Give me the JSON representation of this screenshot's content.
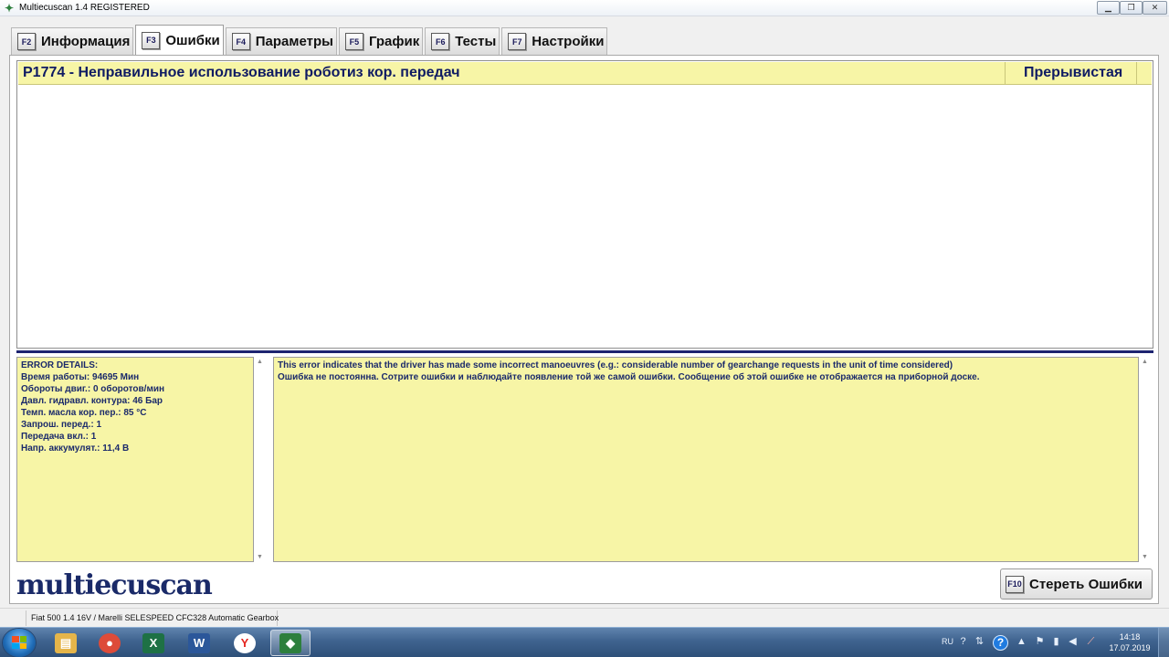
{
  "window": {
    "title": "Multiecuscan 1.4 REGISTERED",
    "min_glyph": "▁",
    "max_glyph": "❐",
    "close_glyph": "✕"
  },
  "tabs": [
    {
      "key": "F2",
      "label": "Информация"
    },
    {
      "key": "F3",
      "label": "Ошибки",
      "active": true
    },
    {
      "key": "F4",
      "label": "Параметры"
    },
    {
      "key": "F5",
      "label": "График"
    },
    {
      "key": "F6",
      "label": "Тесты"
    },
    {
      "key": "F7",
      "label": "Настройки"
    }
  ],
  "errors": {
    "rows": [
      {
        "code": "P1774 - Неправильное использование роботиз кор. передач",
        "status": "Прерывистая"
      }
    ]
  },
  "details": {
    "header": "ERROR DETAILS:",
    "lines": [
      "Время работы: 94695 Мин",
      "Обороты двиг.: 0 оборотов/мин",
      "Давл. гидравл. контура: 46 Бар",
      "Темп. масла кор. пер.: 85 °C",
      "Запрош. перед.: 1",
      "Передача вкл.: 1",
      "Напр. аккумулят.: 11,4 В"
    ]
  },
  "description": {
    "line1": "This error indicates that the driver has made some incorrect manoeuvres (e.g.: considerable number of gearchange requests in the unit of time considered)",
    "line2": "Ошибка не постоянна. Сотрите ошибки и наблюдайте появление той же самой ошибки. Сообщение об этой ошибке не отображается на приборной доске."
  },
  "logo": "multiecuscan",
  "clear_button": {
    "key": "F10",
    "label": "Стереть Ошибки"
  },
  "status": {
    "vehicle": "Fiat 500 1.4 16V / Marelli SELESPEED CFC328 Automatic Gearbox"
  },
  "taskbar": {
    "apps": [
      {
        "name": "explorer",
        "glyph": "▤",
        "color": "#e5b54a"
      },
      {
        "name": "chrome",
        "glyph": "●",
        "color": "#dd4b39"
      },
      {
        "name": "excel",
        "glyph": "X",
        "color": "#1e7145"
      },
      {
        "name": "word",
        "glyph": "W",
        "color": "#2b579a"
      },
      {
        "name": "yandex",
        "glyph": "Y",
        "color": "#e52620"
      },
      {
        "name": "multiecuscan",
        "glyph": "◆",
        "color": "#2d7f3d",
        "active": true
      }
    ],
    "tray": {
      "lang": "RU",
      "time": "14:18",
      "date": "17.07.2019"
    }
  }
}
